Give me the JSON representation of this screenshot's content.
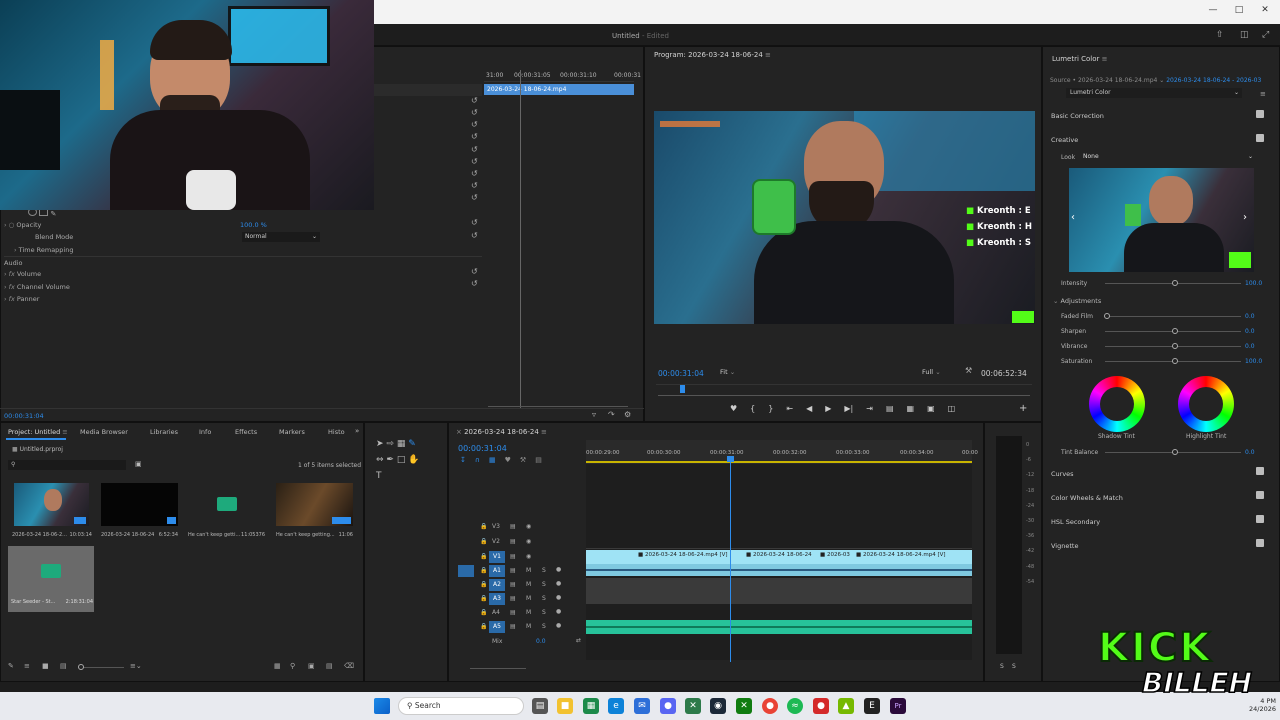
{
  "window": {
    "title": "Untitled",
    "edited": "- Edited"
  },
  "effect_controls": {
    "timecode": "00:00:31:04",
    "clip_name": "2026-03-24 18-06-24.mp4",
    "ruler": [
      "31:00",
      "00:00:31:05",
      "00:00:31:10",
      "00:00:31"
    ],
    "opacity_label": "Opacity",
    "opacity_value": "100.0 %",
    "blend_label": "Blend Mode",
    "blend_value": "Normal",
    "time_remap": "Time Remapping",
    "audio": "Audio",
    "volume": "Volume",
    "channel_volume": "Channel Volume",
    "panner": "Panner"
  },
  "program": {
    "title": "Program: 2026-03-24 18-06-24",
    "timecode": "00:00:31:04",
    "fit": "Fit",
    "quality": "Full",
    "duration": "00:06:52:34",
    "overlay": [
      "Kreonth : E",
      "Kreonth : H",
      "Kreonth : S"
    ]
  },
  "lumetri": {
    "tab": "Lumetri Color",
    "source": "Source • 2026-03-24 18-06-24.mp4",
    "source_link": "2026-03-24 18-06-24 - 2026-03",
    "preset": "Lumetri Color",
    "basic": "Basic Correction",
    "creative": "Creative",
    "look_label": "Look",
    "look_value": "None",
    "intensity_label": "Intensity",
    "intensity_value": "100.0",
    "adjustments": "Adjustments",
    "faded_label": "Faded Film",
    "faded_value": "0.0",
    "sharpen_label": "Sharpen",
    "sharpen_value": "0.0",
    "vibrance_label": "Vibrance",
    "vibrance_value": "0.0",
    "saturation_label": "Saturation",
    "saturation_value": "100.0",
    "shadow_tint": "Shadow Tint",
    "highlight_tint": "Highlight Tint",
    "tint_balance_label": "Tint Balance",
    "tint_balance_value": "0.0",
    "curves": "Curves",
    "wheels": "Color Wheels & Match",
    "hsl": "HSL Secondary",
    "vignette": "Vignette"
  },
  "project": {
    "tabs": [
      "Project: Untitled",
      "Media Browser",
      "Libraries",
      "Info",
      "Effects",
      "Markers",
      "Histo"
    ],
    "file": "Untitled.prproj",
    "selected": "1 of 5 items selected",
    "items": [
      {
        "name": "2026-03-24 18-06-2...",
        "dur": "10:03:14"
      },
      {
        "name": "2026-03-24 18-06-24",
        "dur": "6:52:34"
      },
      {
        "name": "He can't keep getti...",
        "dur": "11:05376"
      },
      {
        "name": "He can't keep getting...",
        "dur": "11:06"
      },
      {
        "name": "Star Seeder - St...",
        "dur": "2:18:31:04"
      }
    ]
  },
  "timeline": {
    "tab": "2026-03-24 18-06-24",
    "timecode": "00:00:31:04",
    "ruler": [
      "00:00:29:00",
      "00:00:30:00",
      "00:00:31:00",
      "00:00:32:00",
      "00:00:33:00",
      "00:00:34:00",
      "00:00"
    ],
    "tracks": [
      "V3",
      "V2",
      "V1",
      "A1",
      "A2",
      "A3",
      "A4",
      "A5"
    ],
    "mix": "Mix",
    "mix_value": "0.0",
    "clips": [
      "2026-03-24 18-06-24.mp4 [V]",
      "2026-03-24 18-06-24",
      "2026-03",
      "2026-03-24 18-06-24.mp4 [V]"
    ]
  },
  "meter": {
    "ticks": [
      "0",
      "-6",
      "-12",
      "-18",
      "-24",
      "-30",
      "-36",
      "-42",
      "-48",
      "-54"
    ],
    "labels": [
      "S",
      "S"
    ]
  },
  "taskbar": {
    "search": "Search",
    "time": "4 PM",
    "date": "24/2026"
  },
  "logo": {
    "line1": "KICK",
    "line2": "BILLEH"
  },
  "colors": {
    "accent": "#2d8ceb",
    "clip_video": "#9fe3f5",
    "clip_audio": "#27c29a",
    "kick_green": "#53fc18"
  }
}
